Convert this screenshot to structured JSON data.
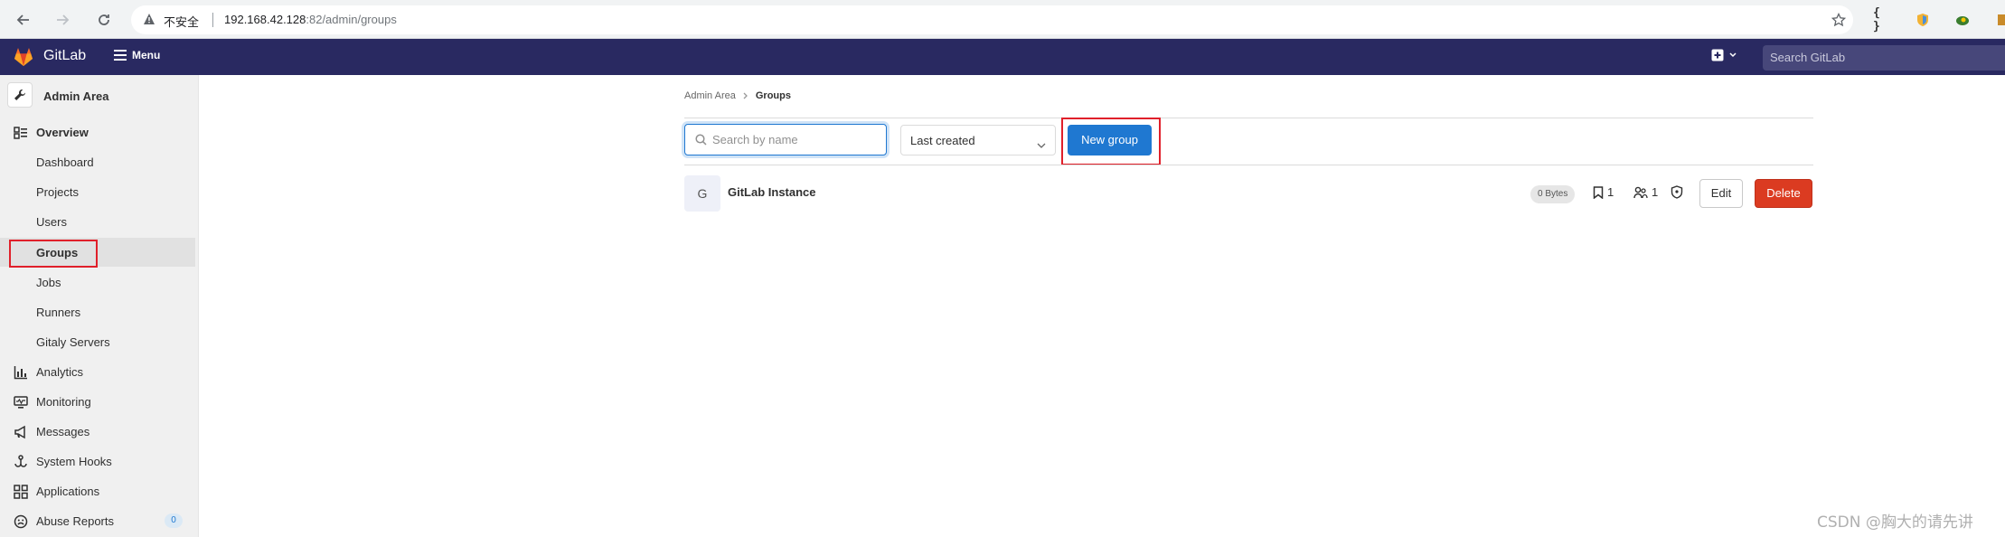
{
  "browser": {
    "insecure_label": "不安全",
    "url_host": "192.168.42.128",
    "url_rest": ":82/admin/groups"
  },
  "topbar": {
    "brand": "GitLab",
    "menu_label": "Menu",
    "search_placeholder": "Search GitLab"
  },
  "sidebar": {
    "title": "Admin Area",
    "overview": "Overview",
    "items": [
      {
        "label": "Dashboard"
      },
      {
        "label": "Projects"
      },
      {
        "label": "Users"
      },
      {
        "label": "Groups"
      },
      {
        "label": "Jobs"
      },
      {
        "label": "Runners"
      },
      {
        "label": "Gitaly Servers"
      }
    ],
    "sections": [
      {
        "label": "Analytics",
        "icon": "chart-icon"
      },
      {
        "label": "Monitoring",
        "icon": "monitor-icon"
      },
      {
        "label": "Messages",
        "icon": "bullhorn-icon"
      },
      {
        "label": "System Hooks",
        "icon": "hook-icon"
      },
      {
        "label": "Applications",
        "icon": "grid-icon"
      },
      {
        "label": "Abuse Reports",
        "icon": "abuse-icon"
      }
    ],
    "abuse_count": "0"
  },
  "breadcrumb": {
    "root": "Admin Area",
    "current": "Groups"
  },
  "filters": {
    "search_placeholder": "Search by name",
    "sort_value": "Last created",
    "new_group_label": "New group"
  },
  "groups": [
    {
      "avatar_letter": "G",
      "name": "GitLab Instance",
      "size": "0 Bytes",
      "projects": "1",
      "members": "1",
      "edit_label": "Edit",
      "delete_label": "Delete"
    }
  ],
  "watermark": "CSDN @胸大的请先讲",
  "colors": {
    "topbar": "#292961",
    "primary": "#1f78d1",
    "danger": "#db3b21",
    "highlight_box": "#e0202a"
  }
}
